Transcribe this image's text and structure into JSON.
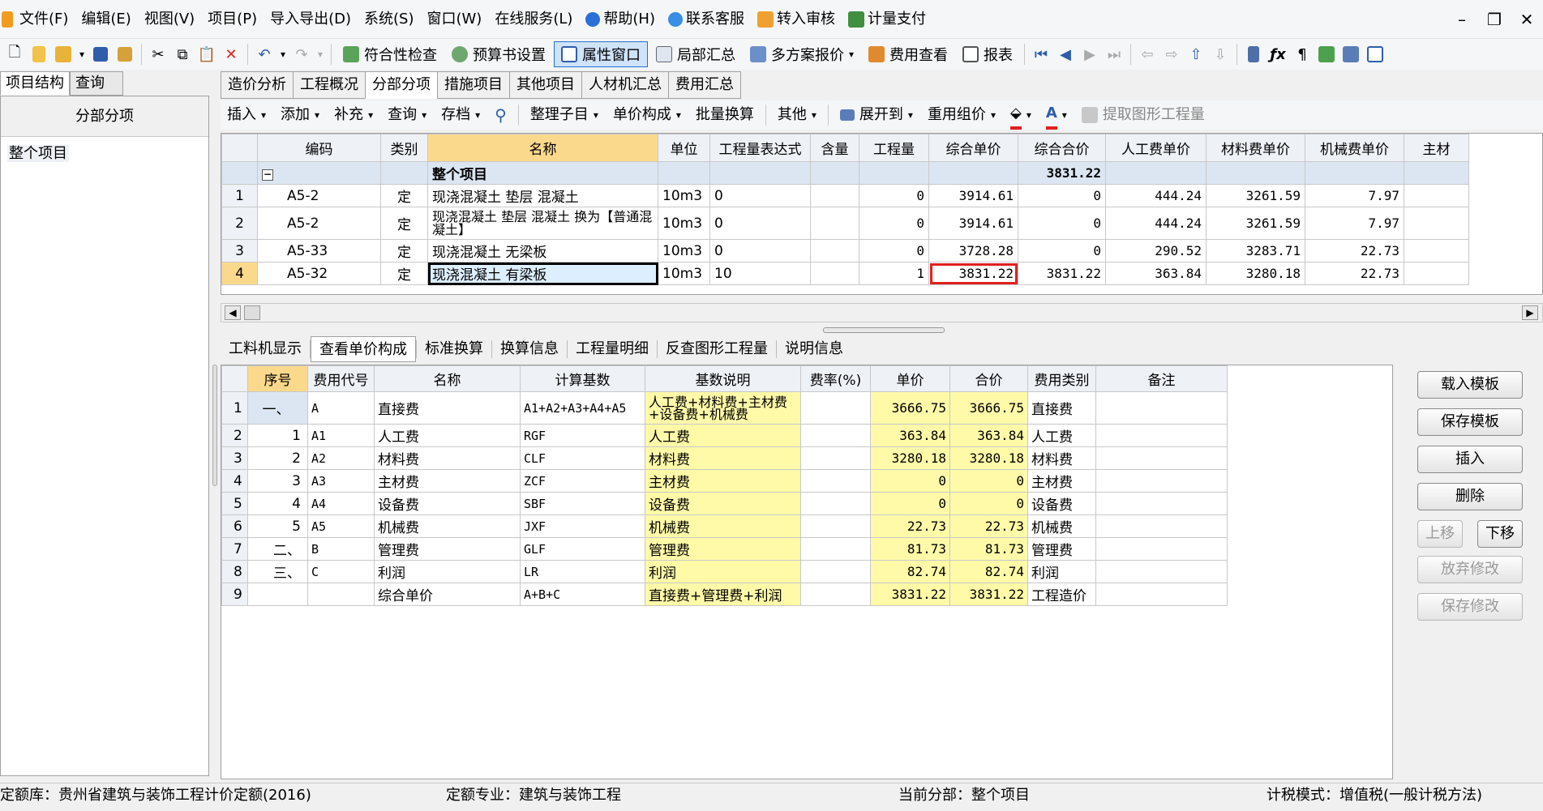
{
  "menu": {
    "file": "文件(F)",
    "edit": "编辑(E)",
    "view": "视图(V)",
    "project": "项目(P)",
    "import_export": "导入导出(D)",
    "system": "系统(S)",
    "window": "窗口(W)",
    "online": "在线服务(L)",
    "help": "帮助(H)",
    "support": "联系客服",
    "audit": "转入审核",
    "payment": "计量支付"
  },
  "toolbar1": {
    "compliance": "符合性检查",
    "budget_setting": "预算书设置",
    "property_window": "属性窗口",
    "partial_summary": "局部汇总",
    "multi_quote": "多方案报价",
    "fee_view": "费用查看",
    "report": "报表"
  },
  "left": {
    "tab_structure": "项目结构",
    "tab_query": "查询",
    "header": "分部分项",
    "root_item": "整个项目"
  },
  "main_tabs": [
    "造价分析",
    "工程概况",
    "分部分项",
    "措施项目",
    "其他项目",
    "人材机汇总",
    "费用汇总"
  ],
  "toolbar2": {
    "insert": "插入",
    "add": "添加",
    "supplement": "补充",
    "query": "查询",
    "archive": "存档",
    "organize": "整理子目",
    "unit_price": "单价构成",
    "batch": "批量换算",
    "other": "其他",
    "expand": "展开到",
    "reuse": "重用组价",
    "extract": "提取图形工程量"
  },
  "grid": {
    "columns": [
      "编码",
      "类别",
      "名称",
      "单位",
      "工程量表达式",
      "含量",
      "工程量",
      "综合单价",
      "综合合价",
      "人工费单价",
      "材料费单价",
      "机械费单价",
      "主材"
    ],
    "group": {
      "name": "整个项目",
      "total": "3831.22"
    },
    "rows": [
      {
        "n": "1",
        "code": "A5-2",
        "type": "定",
        "name": "现浇混凝土 垫层 混凝土",
        "unit": "10m3",
        "expr": "0",
        "content": "",
        "qty": "0",
        "uprice": "3914.61",
        "total": "0",
        "labor": "444.24",
        "material": "3261.59",
        "machine": "7.97"
      },
      {
        "n": "2",
        "code": "A5-2",
        "type": "定",
        "name": "现浇混凝土 垫层 混凝土  换为【普通混凝土】",
        "unit": "10m3",
        "expr": "0",
        "content": "",
        "qty": "0",
        "uprice": "3914.61",
        "total": "0",
        "labor": "444.24",
        "material": "3261.59",
        "machine": "7.97"
      },
      {
        "n": "3",
        "code": "A5-33",
        "type": "定",
        "name": "现浇混凝土 无梁板",
        "unit": "10m3",
        "expr": "0",
        "content": "",
        "qty": "0",
        "uprice": "3728.28",
        "total": "0",
        "labor": "290.52",
        "material": "3283.71",
        "machine": "22.73"
      },
      {
        "n": "4",
        "code": "A5-32",
        "type": "定",
        "name": "现浇混凝土 有梁板",
        "unit": "10m3",
        "expr": "10",
        "content": "",
        "qty": "1",
        "uprice": "3831.22",
        "total": "3831.22",
        "labor": "363.84",
        "material": "3280.18",
        "machine": "22.73"
      }
    ]
  },
  "sub_tabs": [
    "工料机显示",
    "查看单价构成",
    "标准换算",
    "换算信息",
    "工程量明细",
    "反查图形工程量",
    "说明信息"
  ],
  "detail": {
    "columns": [
      "序号",
      "费用代号",
      "名称",
      "计算基数",
      "基数说明",
      "费率(%)",
      "单价",
      "合价",
      "费用类别",
      "备注"
    ],
    "rows": [
      {
        "n": "1",
        "seq": "一、",
        "code": "A",
        "name": "直接费",
        "base": "A1+A2+A3+A4+A5",
        "desc": "人工费+材料费+主材费+设备费+机械费",
        "rate": "",
        "price": "3666.75",
        "sum": "3666.75",
        "cat": "直接费"
      },
      {
        "n": "2",
        "seq": "1",
        "code": "A1",
        "name": "人工费",
        "base": "RGF",
        "desc": "人工费",
        "rate": "",
        "price": "363.84",
        "sum": "363.84",
        "cat": "人工费"
      },
      {
        "n": "3",
        "seq": "2",
        "code": "A2",
        "name": "材料费",
        "base": "CLF",
        "desc": "材料费",
        "rate": "",
        "price": "3280.18",
        "sum": "3280.18",
        "cat": "材料费"
      },
      {
        "n": "4",
        "seq": "3",
        "code": "A3",
        "name": "主材费",
        "base": "ZCF",
        "desc": "主材费",
        "rate": "",
        "price": "0",
        "sum": "0",
        "cat": "主材费"
      },
      {
        "n": "5",
        "seq": "4",
        "code": "A4",
        "name": "设备费",
        "base": "SBF",
        "desc": "设备费",
        "rate": "",
        "price": "0",
        "sum": "0",
        "cat": "设备费"
      },
      {
        "n": "6",
        "seq": "5",
        "code": "A5",
        "name": "机械费",
        "base": "JXF",
        "desc": "机械费",
        "rate": "",
        "price": "22.73",
        "sum": "22.73",
        "cat": "机械费"
      },
      {
        "n": "7",
        "seq": "二、",
        "code": "B",
        "name": "管理费",
        "base": "GLF",
        "desc": "管理费",
        "rate": "",
        "price": "81.73",
        "sum": "81.73",
        "cat": "管理费"
      },
      {
        "n": "8",
        "seq": "三、",
        "code": "C",
        "name": "利润",
        "base": "LR",
        "desc": "利润",
        "rate": "",
        "price": "82.74",
        "sum": "82.74",
        "cat": "利润"
      },
      {
        "n": "9",
        "seq": "",
        "code": "",
        "name": "综合单价",
        "base": "A+B+C",
        "desc": "直接费+管理费+利润",
        "rate": "",
        "price": "3831.22",
        "sum": "3831.22",
        "cat": "工程造价"
      }
    ]
  },
  "right_buttons": {
    "load_template": "载入模板",
    "save_template": "保存模板",
    "insert": "插入",
    "delete": "删除",
    "move_up": "上移",
    "move_down": "下移",
    "discard": "放弃修改",
    "save_changes": "保存修改"
  },
  "status": {
    "quota_lib": "定额库：贵州省建筑与装饰工程计价定额(2016)",
    "quota_major": "定额专业：建筑与装饰工程",
    "current_part": "当前分部：整个项目",
    "tax_mode": "计税模式：增值税(一般计税方法)"
  }
}
